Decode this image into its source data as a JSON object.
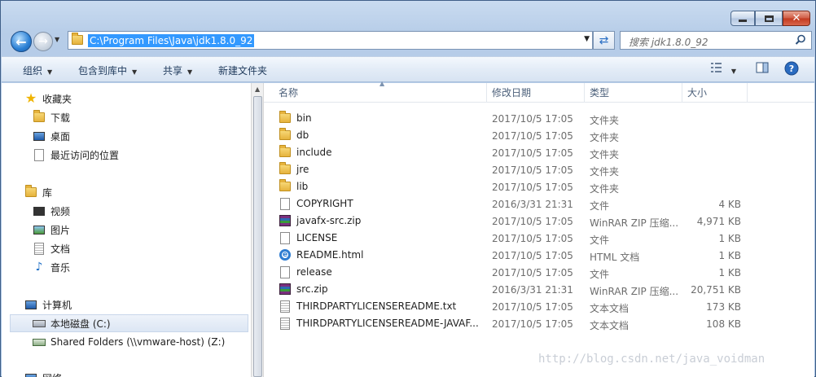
{
  "address": {
    "path": "C:\\Program Files\\Java\\jdk1.8.0_92"
  },
  "search": {
    "placeholder": "搜索 jdk1.8.0_92"
  },
  "toolbar": {
    "organize": "组织",
    "include_in_library": "包含到库中",
    "share": "共享",
    "new_folder": "新建文件夹"
  },
  "nav": {
    "favorites": "收藏夹",
    "downloads": "下载",
    "desktop": "桌面",
    "recent": "最近访问的位置",
    "libraries": "库",
    "videos": "视频",
    "pictures": "图片",
    "documents": "文档",
    "music": "音乐",
    "computer": "计算机",
    "local_disk": "本地磁盘 (C:)",
    "shared_folders": "Shared Folders (\\\\vmware-host) (Z:)",
    "network": "网络"
  },
  "columns": {
    "name": "名称",
    "date": "修改日期",
    "type": "类型",
    "size": "大小"
  },
  "files": [
    {
      "name": "bin",
      "date": "2017/10/5 17:05",
      "type": "文件夹",
      "size": "",
      "icon": "folder"
    },
    {
      "name": "db",
      "date": "2017/10/5 17:05",
      "type": "文件夹",
      "size": "",
      "icon": "folder"
    },
    {
      "name": "include",
      "date": "2017/10/5 17:05",
      "type": "文件夹",
      "size": "",
      "icon": "folder"
    },
    {
      "name": "jre",
      "date": "2017/10/5 17:05",
      "type": "文件夹",
      "size": "",
      "icon": "folder"
    },
    {
      "name": "lib",
      "date": "2017/10/5 17:05",
      "type": "文件夹",
      "size": "",
      "icon": "folder"
    },
    {
      "name": "COPYRIGHT",
      "date": "2016/3/31 21:31",
      "type": "文件",
      "size": "4 KB",
      "icon": "doc"
    },
    {
      "name": "javafx-src.zip",
      "date": "2017/10/5 17:05",
      "type": "WinRAR ZIP 压缩...",
      "size": "4,971 KB",
      "icon": "rar"
    },
    {
      "name": "LICENSE",
      "date": "2017/10/5 17:05",
      "type": "文件",
      "size": "1 KB",
      "icon": "doc"
    },
    {
      "name": "README.html",
      "date": "2017/10/5 17:05",
      "type": "HTML 文档",
      "size": "1 KB",
      "icon": "ie"
    },
    {
      "name": "release",
      "date": "2017/10/5 17:05",
      "type": "文件",
      "size": "1 KB",
      "icon": "doc"
    },
    {
      "name": "src.zip",
      "date": "2016/3/31 21:31",
      "type": "WinRAR ZIP 压缩...",
      "size": "20,751 KB",
      "icon": "rar"
    },
    {
      "name": "THIRDPARTYLICENSEREADME.txt",
      "date": "2017/10/5 17:05",
      "type": "文本文档",
      "size": "173 KB",
      "icon": "doc-txt"
    },
    {
      "name": "THIRDPARTYLICENSEREADME-JAVAF...",
      "date": "2017/10/5 17:05",
      "type": "文本文档",
      "size": "108 KB",
      "icon": "doc-txt"
    }
  ],
  "watermark": "http://blog.csdn.net/java_voidman",
  "colors": {
    "selection": "#3399ff",
    "frame": "#b7cde8"
  }
}
